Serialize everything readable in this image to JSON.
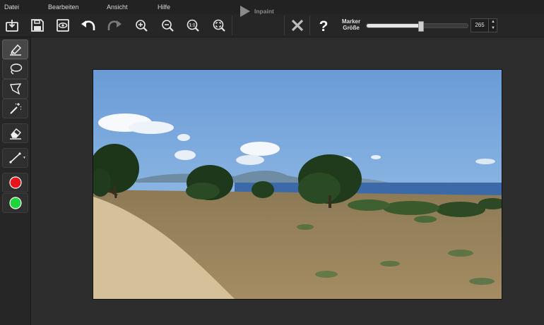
{
  "menu": {
    "items": [
      {
        "label": "Datei"
      },
      {
        "label": "Bearbeiten"
      },
      {
        "label": "Ansicht"
      },
      {
        "label": "Hilfe"
      }
    ]
  },
  "toolbar": {
    "buttons": [
      {
        "name": "open-file",
        "icon": "open-file-icon"
      },
      {
        "name": "save",
        "icon": "save-icon"
      },
      {
        "name": "preview",
        "icon": "eye-icon"
      },
      {
        "name": "undo",
        "icon": "undo-icon"
      },
      {
        "name": "redo",
        "icon": "redo-icon"
      },
      {
        "name": "zoom-in",
        "icon": "zoom-in-icon"
      },
      {
        "name": "zoom-out",
        "icon": "zoom-out-icon"
      },
      {
        "name": "zoom-actual",
        "icon": "zoom-1to1-icon"
      },
      {
        "name": "zoom-fit",
        "icon": "zoom-fit-icon"
      }
    ],
    "inpaint_label": "Inpaint",
    "marker_label_line1": "Marker",
    "marker_label_line2": "Größe",
    "marker_size": "265",
    "marker_slider_fraction": 0.53
  },
  "sidebar": {
    "tools": [
      {
        "name": "marker",
        "icon": "marker-icon",
        "active": true
      },
      {
        "name": "lasso",
        "icon": "lasso-icon",
        "active": false
      },
      {
        "name": "polygon-lasso",
        "icon": "polygon-lasso-icon",
        "active": false
      },
      {
        "name": "magic-wand",
        "icon": "magic-wand-icon",
        "active": false
      },
      {
        "name": "eraser",
        "icon": "eraser-icon",
        "active": false
      },
      {
        "name": "line",
        "icon": "line-icon",
        "active": false
      },
      {
        "name": "red-color",
        "icon": "red-dot-icon",
        "active": false
      },
      {
        "name": "green-color",
        "icon": "green-dot-icon",
        "active": false
      }
    ]
  },
  "colors": {
    "red_marker": "#e8141b",
    "green_marker": "#1ed63a",
    "background": "#2c2c2c"
  }
}
